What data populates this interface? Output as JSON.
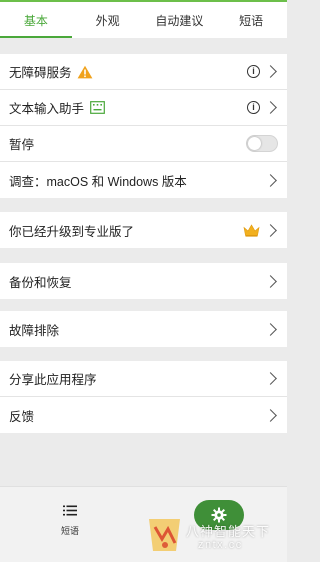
{
  "tabs": [
    {
      "label": "基本",
      "active": true
    },
    {
      "label": "外观",
      "active": false
    },
    {
      "label": "自动建议",
      "active": false
    },
    {
      "label": "短语",
      "active": false
    }
  ],
  "settings": {
    "accessibility": "无障碍服务",
    "text_input_assistant": "文本输入助手",
    "pause": "暂停",
    "pause_enabled": false,
    "survey": "调查：macOS 和 Windows 版本",
    "upgraded_pro": "你已经升级到专业版了",
    "backup_restore": "备份和恢复",
    "troubleshoot": "故障排除",
    "share_app": "分享此应用程序",
    "feedback": "反馈"
  },
  "bottom_nav": {
    "phrases_label": "短语"
  },
  "watermark": {
    "line1": "八神智能天下",
    "line2": "zntx.cc"
  },
  "colors": {
    "accent_green": "#4aa83a",
    "warning_orange": "#f0a21c",
    "crown_gold": "#f2b01e",
    "gear_button": "#3f8f38"
  }
}
